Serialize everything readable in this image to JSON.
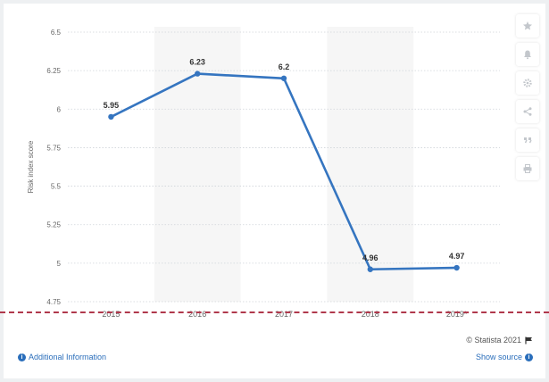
{
  "chart_data": {
    "type": "line",
    "x": [
      "2015",
      "2016",
      "2017",
      "2018",
      "2019*"
    ],
    "series": [
      {
        "values": [
          5.95,
          6.23,
          6.2,
          4.96,
          4.97
        ]
      }
    ],
    "data_labels": [
      "5.95",
      "6.23",
      "6.2",
      "4.96",
      "4.97"
    ],
    "ylabel": "Risk index score",
    "xlabel": "",
    "ylim": [
      4.75,
      6.5
    ],
    "yticks": [
      {
        "value": 4.75,
        "label": "4.75"
      },
      {
        "value": 5,
        "label": "5"
      },
      {
        "value": 5.25,
        "label": "5.25"
      },
      {
        "value": 5.5,
        "label": "5.5"
      },
      {
        "value": 5.75,
        "label": "5.75"
      },
      {
        "value": 6,
        "label": "6"
      },
      {
        "value": 6.25,
        "label": "6.25"
      },
      {
        "value": 6.5,
        "label": "6.5"
      }
    ],
    "grid": "horizontal dotted",
    "line_color": "#3575c0",
    "band_color": "#f6f6f6"
  },
  "toolbar": {
    "icons": [
      "star-icon",
      "bell-icon",
      "gear-icon",
      "share-icon",
      "quote-icon",
      "print-icon"
    ]
  },
  "footer": {
    "credit": "© Statista 2021",
    "additional_info": "Additional Information",
    "show_source": "Show source"
  },
  "colors": {
    "link": "#2a6ebb",
    "divider": "#b0384c"
  }
}
